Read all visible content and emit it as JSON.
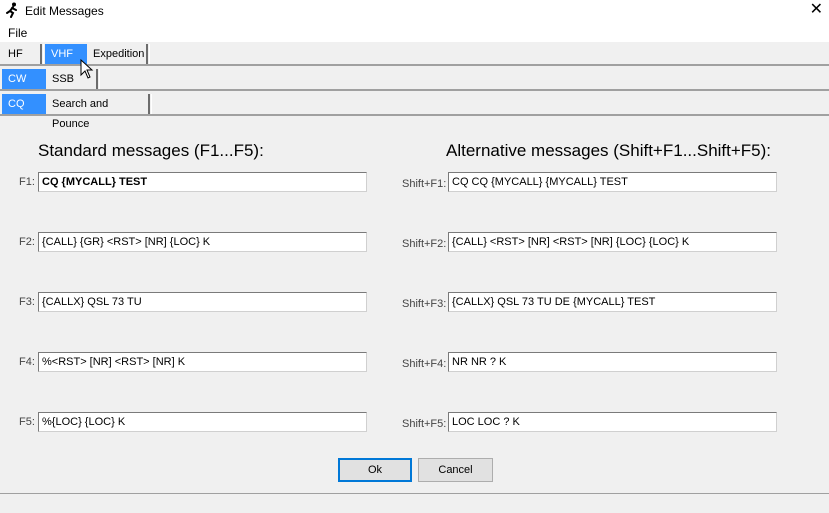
{
  "window": {
    "title": "Edit Messages",
    "close_glyph": "✕"
  },
  "menu": {
    "file": "File"
  },
  "band_tabs": [
    {
      "label": "HF",
      "selected": false
    },
    {
      "label": "VHF",
      "selected": true
    },
    {
      "label": "Expedition",
      "selected": false
    }
  ],
  "mode_tabs": [
    {
      "label": "CW",
      "selected": true
    },
    {
      "label": "SSB",
      "selected": false
    }
  ],
  "type_tabs": [
    {
      "label": "CQ",
      "selected": true
    },
    {
      "label": "Search and Pounce",
      "selected": false
    }
  ],
  "standard": {
    "heading": "Standard messages (F1...F5):",
    "rows": [
      {
        "label": "F1:",
        "value": "CQ {MYCALL} TEST"
      },
      {
        "label": "F2:",
        "value": "{CALL} {GR} <RST> [NR] {LOC} K"
      },
      {
        "label": "F3:",
        "value": "{CALLX} QSL 73 TU"
      },
      {
        "label": "F4:",
        "value": "%<RST> [NR] <RST> [NR] K"
      },
      {
        "label": "F5:",
        "value": "%{LOC} {LOC} K"
      }
    ]
  },
  "alternative": {
    "heading": "Alternative messages (Shift+F1...Shift+F5):",
    "rows": [
      {
        "label": "Shift+F1:",
        "value": "CQ CQ {MYCALL} {MYCALL} TEST"
      },
      {
        "label": "Shift+F2:",
        "value": "{CALL} <RST> [NR] <RST> [NR] {LOC} {LOC} K"
      },
      {
        "label": "Shift+F3:",
        "value": "{CALLX} QSL 73 TU DE {MYCALL} TEST"
      },
      {
        "label": "Shift+F4:",
        "value": "NR NR ? K"
      },
      {
        "label": "Shift+F5:",
        "value": "LOC LOC ? K"
      }
    ]
  },
  "buttons": {
    "ok": "Ok",
    "cancel": "Cancel"
  },
  "colors": {
    "selected_tab": "#3390ff",
    "window_bg": "#f0f0f0"
  }
}
